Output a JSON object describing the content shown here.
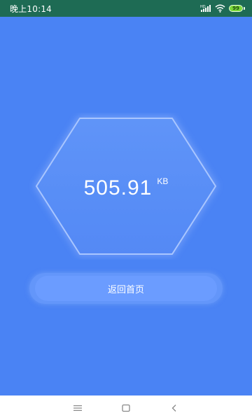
{
  "status_bar": {
    "time": "晚上10:14",
    "network_type": "HD",
    "battery_level": "99",
    "icons": [
      "signal-icon",
      "wifi-icon",
      "battery-icon"
    ]
  },
  "result": {
    "value": "505.91",
    "unit": "KB"
  },
  "actions": {
    "back_home_label": "返回首页"
  },
  "nav_bar": {
    "buttons": [
      "menu-icon",
      "home-icon",
      "back-icon"
    ]
  },
  "colors": {
    "background": "#4a83f4",
    "status_bar": "#1e6b54",
    "hexagon_fill": "#5a8ff7",
    "button": "#6b9cff",
    "nav_bar": "#ffffff"
  }
}
